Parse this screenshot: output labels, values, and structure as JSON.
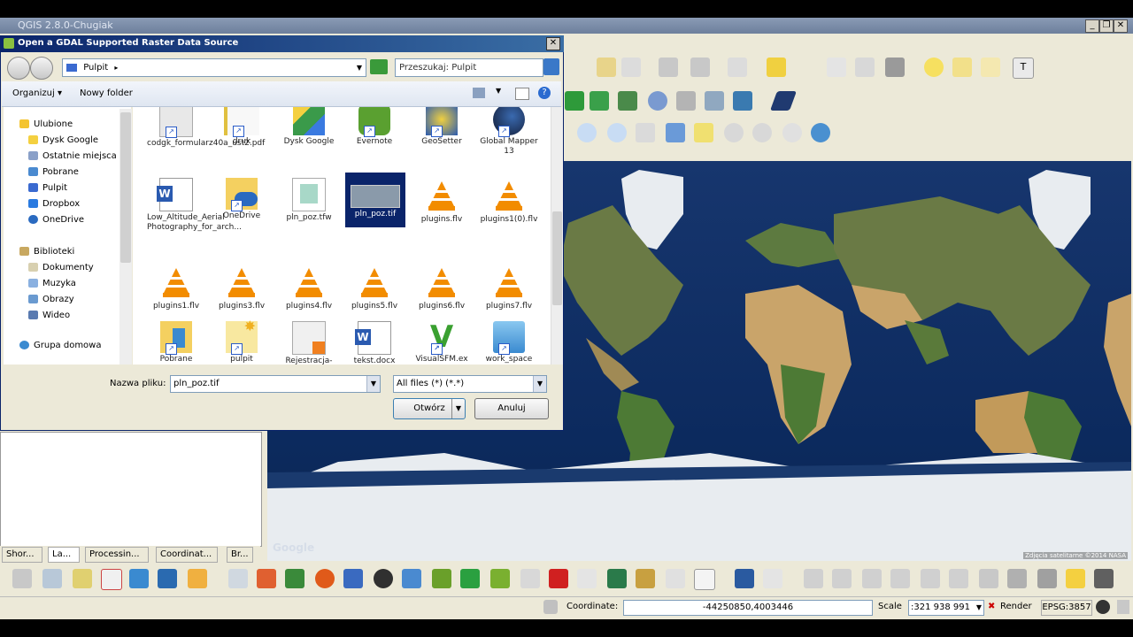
{
  "qgis": {
    "title": "QGIS 2.8.0-Chugiak",
    "bottom_tabs": [
      "Shor...",
      "La...",
      "Processin...",
      "Coordinat...",
      "Br..."
    ],
    "status": {
      "coordinate_label": "Coordinate:",
      "coordinate_value": "-44250850,4003446",
      "scale_label": "Scale",
      "scale_value": ":321 938 991",
      "render_label": "Render",
      "epsg": "EPSG:3857"
    },
    "map": {
      "attribution": "Zdjęcia satelitarne ©2014 NASA",
      "google_watermark": "Google"
    }
  },
  "dialog": {
    "title": "Open a GDAL Supported Raster Data Source",
    "address": "Pulpit",
    "search_placeholder": "Przeszukaj: Pulpit",
    "organize": "Organizuj",
    "new_folder": "Nowy folder",
    "nav": {
      "favorites": "Ulubione",
      "favorites_items": [
        "Dysk Google",
        "Ostatnie miejsca",
        "Pobrane",
        "Pulpit",
        "Dropbox",
        "OneDrive"
      ],
      "libraries": "Biblioteki",
      "libraries_items": [
        "Dokumenty",
        "Muzyka",
        "Obrazy",
        "Wideo"
      ],
      "homegroup": "Grupa domowa"
    },
    "files": [
      "codgk_formularz40a_ust2.pdf",
      "druk",
      "Dysk Google",
      "Evernote",
      "GeoSetter",
      "Global Mapper 13",
      "Low_Altitude_Aerial Photography_for_arch...",
      "OneDrive",
      "pln_poz.tfw",
      "pln_poz.tif",
      "plugins.flv",
      "plugins1(0).flv",
      "plugins1.flv",
      "plugins3.flv",
      "plugins4.flv",
      "plugins5.flv",
      "plugins6.flv",
      "plugins7.flv",
      "Pobrane",
      "pulpit",
      "Rejestracja-",
      "tekst.docx",
      "VisualSFM.ex",
      "work_space"
    ],
    "file_name_label": "Nazwa pliku:",
    "file_name_value": "pln_poz.tif",
    "file_type": "All files (*) (*.*)",
    "open_button": "Otwórz",
    "cancel_button": "Anuluj"
  },
  "colors": {
    "dialog_title": "#0a246a",
    "selection": "#0a246a",
    "ocean": "#0d2a5c",
    "land": "#5a7a3a",
    "desert": "#c9a46a",
    "ice": "#e8ecf0"
  }
}
